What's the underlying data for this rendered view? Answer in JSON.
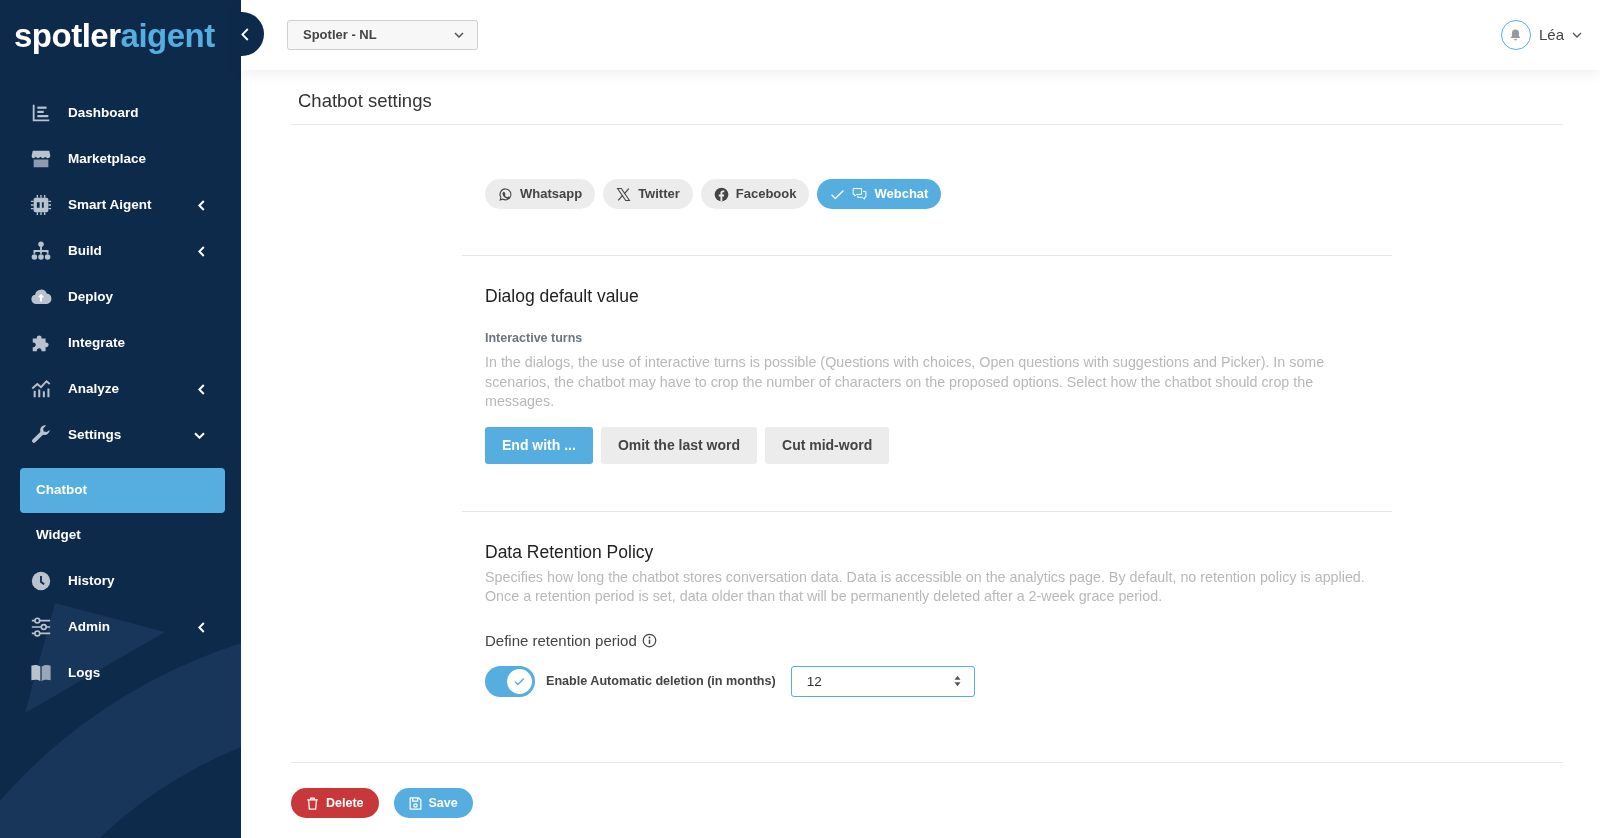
{
  "logo": {
    "brand": "spotler",
    "product": "aigent"
  },
  "sidebar": {
    "items": [
      {
        "label": "Dashboard",
        "kind": "link",
        "selected": false
      },
      {
        "label": "Marketplace",
        "kind": "link",
        "selected": false
      },
      {
        "label": "Smart Aigent",
        "kind": "group",
        "expanded": false,
        "selected": false
      },
      {
        "label": "Build",
        "kind": "group",
        "expanded": false,
        "selected": false
      },
      {
        "label": "Deploy",
        "kind": "link",
        "selected": false
      },
      {
        "label": "Integrate",
        "kind": "link",
        "selected": false
      },
      {
        "label": "Analyze",
        "kind": "group",
        "expanded": false,
        "selected": false
      },
      {
        "label": "Settings",
        "kind": "group",
        "expanded": true,
        "selected": false,
        "children": [
          {
            "label": "Chatbot",
            "selected": true
          },
          {
            "label": "Widget",
            "selected": false
          }
        ]
      },
      {
        "label": "History",
        "kind": "link",
        "selected": false
      },
      {
        "label": "Admin",
        "kind": "group",
        "expanded": false,
        "selected": false
      },
      {
        "label": "Logs",
        "kind": "link",
        "selected": false
      }
    ]
  },
  "topbar": {
    "project_select": {
      "value": "Spotler - NL"
    },
    "user": {
      "name": "Léa"
    }
  },
  "page": {
    "title": "Chatbot settings"
  },
  "channels": [
    {
      "label": "Whatsapp",
      "selected": false
    },
    {
      "label": "Twitter",
      "selected": false
    },
    {
      "label": "Facebook",
      "selected": false
    },
    {
      "label": "Webchat",
      "selected": true
    }
  ],
  "dialog_defaults": {
    "title": "Dialog default value",
    "interactive_turns": {
      "label": "Interactive turns",
      "description": "In the dialogs, the use of interactive turns is possible (Questions with choices, Open questions with suggestions and Picker). In some scenarios, the chatbot may have to crop the number of characters on the proposed options. Select how the chatbot should crop the messages.",
      "options": [
        {
          "label": "End with ...",
          "selected": true
        },
        {
          "label": "Omit the last word",
          "selected": false
        },
        {
          "label": "Cut mid-word",
          "selected": false
        }
      ]
    }
  },
  "retention": {
    "title": "Data Retention Policy",
    "description": "Specifies how long the chatbot stores conversation data. Data is accessible on the analytics page. By default, no retention policy is applied. Once a retention period is set, data older than that will be permanently deleted after a 2-week grace period.",
    "period_label": "Define retention period",
    "auto_deletion": {
      "label": "Enable Automatic deletion (in months)",
      "on": true,
      "value": "12"
    }
  },
  "actions": [
    {
      "label": "Delete",
      "kind": "delete"
    },
    {
      "label": "Save",
      "kind": "save"
    }
  ]
}
